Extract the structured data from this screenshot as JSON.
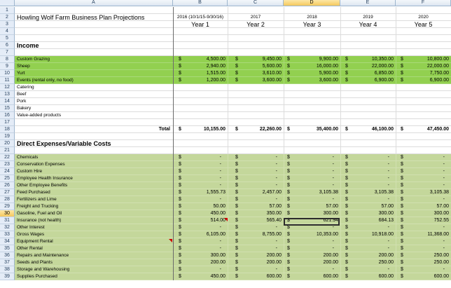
{
  "columns": [
    "A",
    "B",
    "C",
    "D",
    "E",
    "F"
  ],
  "selected_column": "D",
  "selected_row": 30,
  "colors": {
    "income_fill": "#92d050",
    "expense_fill": "#c4d79b",
    "header_bg": "#e4ecf7",
    "selected_header": "#f5c85d",
    "comment_marker": "#d00000"
  },
  "rows": [
    {
      "n": 1
    },
    {
      "n": 2,
      "title": "Howling Wolf Farm Business Plan Projections",
      "cols": [
        "2016 (10/1/15-9/30/16)",
        "2017",
        "2018",
        "2019",
        "2020"
      ]
    },
    {
      "n": 3,
      "years": [
        "Year 1",
        "Year 2",
        "Year 3",
        "Year 4",
        "Year 5"
      ]
    },
    {
      "n": 4
    },
    {
      "n": 5
    },
    {
      "n": 6,
      "section": "Income"
    },
    {
      "n": 7
    },
    {
      "n": 8,
      "fill": "green",
      "label": "Custom Grazing",
      "vals": [
        "4,500.00",
        "9,450.00",
        "9,900.00",
        "10,350.00",
        "10,800.00"
      ]
    },
    {
      "n": 9,
      "fill": "green",
      "label": "Sheep",
      "vals": [
        "2,940.00",
        "5,600.00",
        "16,000.00",
        "22,000.00",
        "22,000.00"
      ]
    },
    {
      "n": 10,
      "fill": "green",
      "label": "Yurt",
      "vals": [
        "1,515.00",
        "3,610.00",
        "5,900.00",
        "6,850.00",
        "7,750.00"
      ]
    },
    {
      "n": 11,
      "fill": "green",
      "label": "Events (rental only, no food)",
      "vals": [
        "1,200.00",
        "3,600.00",
        "3,600.00",
        "6,900.00",
        "6,900.00"
      ]
    },
    {
      "n": 12,
      "label": "Catering"
    },
    {
      "n": 13,
      "label": "Beef"
    },
    {
      "n": 14,
      "label": "Pork"
    },
    {
      "n": 15,
      "label": "Bakery"
    },
    {
      "n": 16,
      "label": "Value-added products"
    },
    {
      "n": 17
    },
    {
      "n": 18,
      "total_label": "Total",
      "totals": [
        "10,155.00",
        "22,260.00",
        "35,400.00",
        "46,100.00",
        "47,450.00"
      ]
    },
    {
      "n": 19
    },
    {
      "n": 20,
      "section": "Direct Expenses/Variable Costs"
    },
    {
      "n": 21
    },
    {
      "n": 22,
      "fill": "lgreen",
      "label": "Chemicals",
      "vals": [
        "-",
        "-",
        "-",
        "-",
        "-"
      ]
    },
    {
      "n": 23,
      "fill": "lgreen",
      "label": "Conservation Expenses",
      "vals": [
        "-",
        "-",
        "-",
        "-",
        "-"
      ]
    },
    {
      "n": 24,
      "fill": "lgreen",
      "label": "Custom Hire",
      "vals": [
        "-",
        "-",
        "-",
        "-",
        "-"
      ]
    },
    {
      "n": 25,
      "fill": "lgreen",
      "label": "Employee Health Insurance",
      "vals": [
        "-",
        "-",
        "-",
        "-",
        "-"
      ]
    },
    {
      "n": 26,
      "fill": "lgreen",
      "label": "Other Employee Benefits",
      "vals": [
        "-",
        "-",
        "-",
        "-",
        "-"
      ]
    },
    {
      "n": 27,
      "fill": "lgreen",
      "label": "Feed Purchased",
      "vals": [
        "1,555.73",
        "2,457.00",
        "3,105.38",
        "3,105.38",
        "3,105.38"
      ]
    },
    {
      "n": 28,
      "fill": "lgreen",
      "label": "Fertilizers and Lime",
      "vals": [
        "-",
        "-",
        "-",
        "-",
        "-"
      ]
    },
    {
      "n": 29,
      "fill": "lgreen",
      "label": "Freight and Trucking",
      "vals": [
        "50.00",
        "57.00",
        "57.00",
        "57.00",
        "57.00"
      ]
    },
    {
      "n": 30,
      "fill": "lgreen",
      "label": "Gasoline, Fuel and Oil",
      "vals": [
        "450.00",
        "350.00",
        "300.00",
        "300.00",
        "300.00"
      ]
    },
    {
      "n": 31,
      "fill": "lgreen",
      "label": "Insurance (not health)",
      "vals": [
        "514.00",
        "565.40",
        "621.94",
        "684.13",
        "752.55"
      ]
    },
    {
      "n": 32,
      "fill": "lgreen",
      "label": "Other Interest",
      "vals": [
        "-",
        "-",
        "-",
        "-",
        "-"
      ]
    },
    {
      "n": 33,
      "fill": "lgreen",
      "label": "Gross Wages",
      "vals": [
        "6,105.00",
        "8,755.00",
        "10,353.00",
        "10,918.00",
        "11,368.00"
      ]
    },
    {
      "n": 34,
      "fill": "lgreen",
      "label": "Equipment Rental",
      "vals": [
        "-",
        "-",
        "-",
        "-",
        "-"
      ]
    },
    {
      "n": 35,
      "fill": "lgreen",
      "label": "Other Rental",
      "vals": [
        "-",
        "-",
        "-",
        "-",
        "-"
      ]
    },
    {
      "n": 36,
      "fill": "lgreen",
      "label": "Repairs and Maintenance",
      "vals": [
        "300.00",
        "200.00",
        "200.00",
        "200.00",
        "250.00"
      ]
    },
    {
      "n": 37,
      "fill": "lgreen",
      "label": "Seeds and Plants",
      "vals": [
        "200.00",
        "200.00",
        "200.00",
        "250.00",
        "250.00"
      ]
    },
    {
      "n": 38,
      "fill": "lgreen",
      "label": "Storage and Warehousing",
      "vals": [
        "-",
        "-",
        "-",
        "-",
        "-"
      ]
    },
    {
      "n": 39,
      "fill": "lgreen",
      "label": "Supplies Purchased",
      "vals": [
        "450.00",
        "600.00",
        "600.00",
        "600.00",
        "600.00"
      ]
    }
  ],
  "currency_symbol": "$"
}
